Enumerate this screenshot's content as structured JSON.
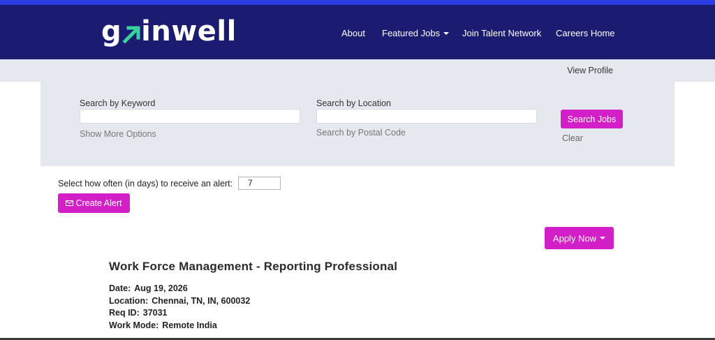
{
  "brand": {
    "logo_text_start": "g",
    "logo_text_end": "inwell",
    "colors": {
      "top_strip": "#2b3de0",
      "header_bg": "#1c1b72",
      "accent": "#d21fc7",
      "panel_bg": "#e6e8ef",
      "logo_arrow": "#36d39c"
    }
  },
  "nav": {
    "about": "About",
    "featured_jobs": "Featured Jobs",
    "join_talent_network": "Join Talent Network",
    "careers_home": "Careers Home"
  },
  "profile": {
    "view_profile": "View Profile"
  },
  "search": {
    "keyword_label": "Search by Keyword",
    "keyword_value": "",
    "location_label": "Search by Location",
    "location_value": "",
    "show_more_options": "Show More Options",
    "postal_code_link": "Search by Postal Code",
    "search_button": "Search Jobs",
    "clear_link": "Clear"
  },
  "alert": {
    "label": "Select how often (in days) to receive an alert:",
    "days_value": "7",
    "create_button": "Create Alert",
    "icon": "envelope-icon"
  },
  "apply": {
    "label": "Apply Now"
  },
  "job": {
    "title": "Work Force Management - Reporting Professional",
    "date_label": "Date:",
    "date_value": "Aug 19, 2026",
    "location_label": "Location:",
    "location_value": "Chennai, TN, IN, 600032",
    "req_id_label": "Req ID:",
    "req_id_value": "37031",
    "work_mode_label": "Work Mode:",
    "work_mode_value": "Remote India"
  }
}
